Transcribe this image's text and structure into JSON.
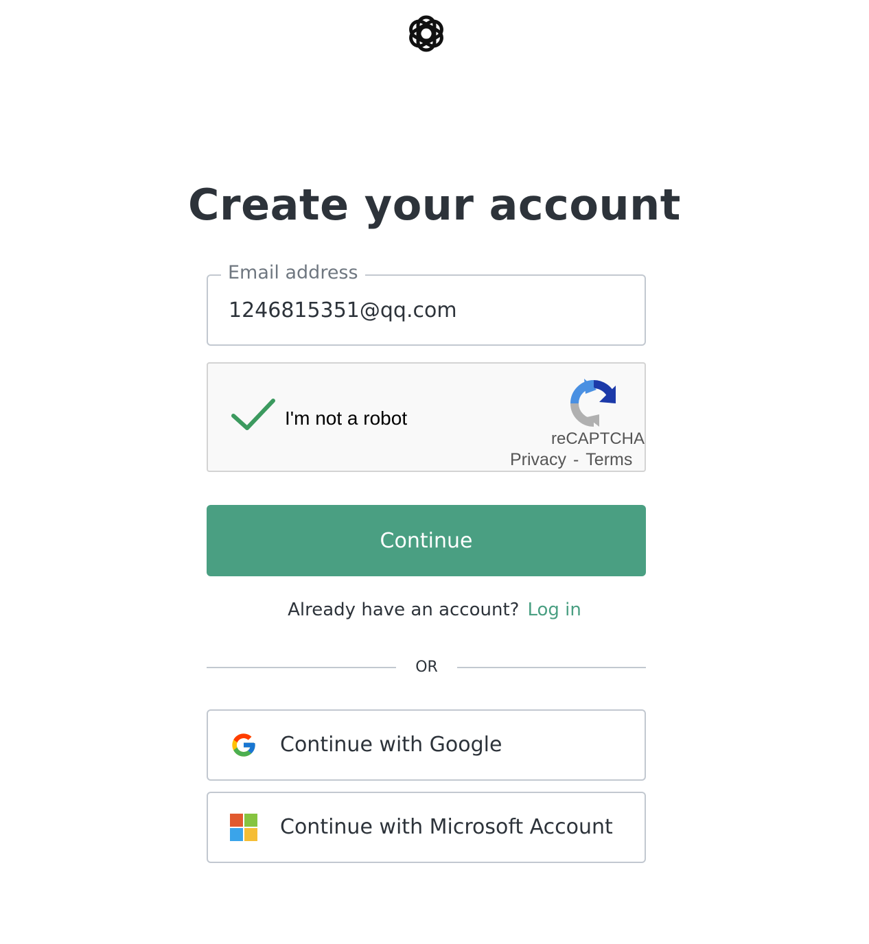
{
  "header": {
    "logo_icon": "openai-logo-icon"
  },
  "page": {
    "title": "Create your account"
  },
  "email": {
    "label": "Email address",
    "value": "1246815351@qq.com"
  },
  "recaptcha": {
    "checked": true,
    "label": "I'm not a robot",
    "brand": "reCAPTCHA",
    "privacy_label": "Privacy",
    "separator": "-",
    "terms_label": "Terms",
    "check_color": "#3c9a5f",
    "icon": "recaptcha-logo-icon"
  },
  "actions": {
    "continue_label": "Continue",
    "continue_color": "#4a9f82"
  },
  "login": {
    "prompt": "Already have an account?",
    "link_label": "Log in"
  },
  "divider": {
    "label": "OR"
  },
  "social": {
    "google_label": "Continue with Google",
    "google_icon": "google-logo-icon",
    "microsoft_label": "Continue with Microsoft Account",
    "microsoft_icon": "microsoft-logo-icon",
    "microsoft_colors": [
      "#f25022",
      "#7fba00",
      "#00a4ef",
      "#ffb900"
    ]
  }
}
